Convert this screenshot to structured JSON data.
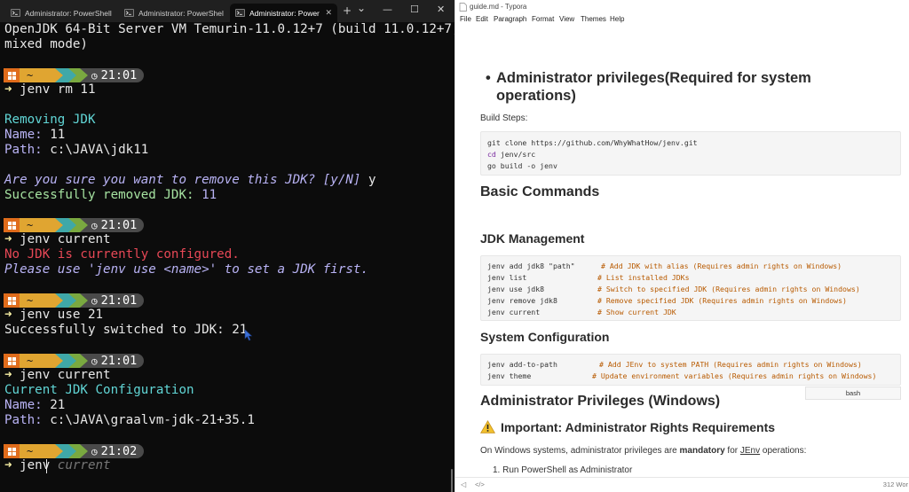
{
  "terminal": {
    "tabs": [
      {
        "label": "Administrator: PowerShell",
        "active": false
      },
      {
        "label": "Administrator: PowerShell",
        "active": false
      },
      {
        "label": "Administrator: PowerShe",
        "active": true
      }
    ],
    "new_tab_glyph": "+",
    "dropdown_glyph": "⌄",
    "window_controls": {
      "minimize": "—",
      "maximize": "☐",
      "close": "✕"
    },
    "lines": {
      "l1": "OpenJDK 64-Bit Server VM Temurin-11.0.12+7 (build 11.0.12+7,",
      "l2": "mixed mode)",
      "cmd1": "jenv rm 11",
      "removing": "Removing JDK",
      "name_label": "Name:",
      "name_value_11": " 11",
      "path_label": "Path:",
      "path_value_11": " c:\\JAVA\\jdk11",
      "confirm": "Are you sure you want to remove this JDK? [y/N]",
      "confirm_answer": " y",
      "removed": "Successfully removed JDK:",
      "removed_value": " 11",
      "cmd2": "jenv current",
      "no_jdk": "No JDK is currently configured.",
      "please_use": "Please use 'jenv use <name>' to set a JDK first.",
      "cmd3": "jenv use 21",
      "switched": "Successfully switched to JDK: 21",
      "cmd4": "jenv current",
      "current_cfg": "Current JDK Configuration",
      "name_value_21": " 21",
      "path_value_21": " c:\\JAVA\\graalvm-jdk-21+35.1",
      "cmd5_typed": "jenv",
      "cmd5_ghost": " current"
    },
    "prompt_arrow": "➜",
    "prompt_home": "~",
    "prompt_times": [
      "21:01",
      "21:01",
      "21:01",
      "21:01",
      "21:02"
    ],
    "colors": {
      "win_seg": "#e06c1b",
      "tilde_seg": "#e0a531",
      "arrow_seg1": "#3fa8a8",
      "arrow_seg2": "#7aa940",
      "clock_seg": "#4a4a4a"
    }
  },
  "typora": {
    "title": "guide.md - Typora",
    "menu": [
      "File",
      "Edit",
      "Paragraph",
      "Format",
      "View",
      "Themes",
      "Help"
    ],
    "admin_heading_li": "Administrator privileges(Required for system",
    "admin_heading_li2": "operations)",
    "build_steps": "Build Steps:",
    "build_code": {
      "line1": "git clone https://github.com/WhyWhatHow/jenv.git",
      "line2_kw": "cd",
      "line2_rest": " jenv/src",
      "line3": "go build -o jenv"
    },
    "basic_commands": "Basic Commands",
    "jdk_management": "JDK Management",
    "jdk_code": [
      {
        "cmd": "jenv add jdk8 \"path\"",
        "comment": "# Add JDK with alias (Requires admin rights on Windows)"
      },
      {
        "cmd": "jenv list",
        "comment": "# List installed JDKs"
      },
      {
        "cmd": "jenv use jdk8",
        "comment": "# Switch to specified JDK (Requires admin rights on Windows)"
      },
      {
        "cmd": "jenv remove jdk8",
        "comment": "# Remove specified JDK (Requires admin rights on Windows)"
      },
      {
        "cmd": "jenv current",
        "comment": "# Show current JDK"
      }
    ],
    "system_configuration": "System Configuration",
    "sys_code": [
      {
        "cmd": "jenv add-to-path",
        "comment": "# Add JEnv to system PATH (Requires admin rights on Windows)"
      },
      {
        "cmd": "jenv theme",
        "comment": "# Update environment variables (Requires admin rights on Windows)"
      }
    ],
    "lang_tag": "bash",
    "admin_priv_windows": "Administrator Privileges (Windows)",
    "important": "Important: Administrator Rights Requirements",
    "windows_note_pre": "On Windows systems, administrator privileges are ",
    "windows_note_bold": "mandatory",
    "windows_note_mid": " for ",
    "windows_note_link": "JEnv",
    "windows_note_post": " operations:",
    "step1": "1. Run PowerShell as Administrator",
    "status_left": "</>",
    "word_count": "312 Wor",
    "colors": {
      "keyword": "#7a2ca0",
      "comment": "#b85a00",
      "code_bg": "#f5f5f5"
    }
  }
}
